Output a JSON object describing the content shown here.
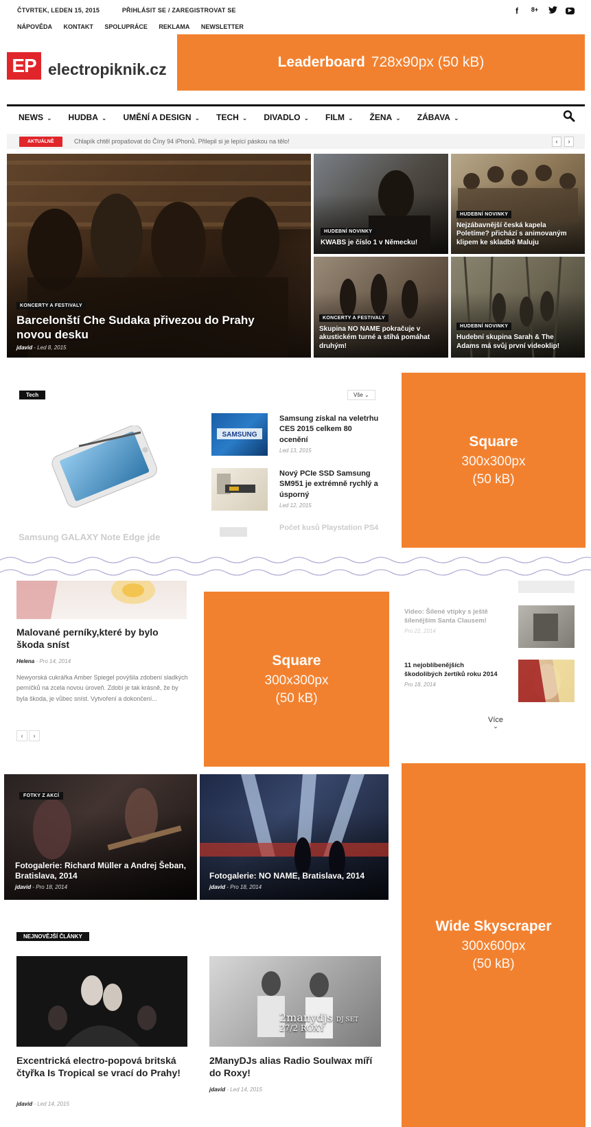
{
  "topbar": {
    "date": "ČTVRTEK, LEDEN 15, 2015",
    "login": "PŘIHLÁSIT SE / ZAREGISTROVAT SE",
    "links": [
      "NÁPOVĚDA",
      "KONTAKT",
      "SPOLUPRÁCE",
      "REKLAMA",
      "NEWSLETTER"
    ],
    "social": [
      "f",
      "8+",
      "▶"
    ]
  },
  "logo": {
    "mark": "EP",
    "name": "electropiknik.cz"
  },
  "ads": {
    "leaderboard": {
      "title": "Leaderboard",
      "size": "728x90px (50 kB)"
    },
    "square1": {
      "title": "Square",
      "size": "300x300px",
      "weight": "(50 kB)"
    },
    "square2": {
      "title": "Square",
      "size": "300x300px",
      "weight": "(50 kB)"
    },
    "skyscraper": {
      "title": "Wide Skyscraper",
      "size": "300x600px",
      "weight": "(50 kB)"
    }
  },
  "nav": {
    "items": [
      "NEWS",
      "HUDBA",
      "UMĚNÍ A DESIGN",
      "TECH",
      "DIVADLO",
      "FILM",
      "ŽENA",
      "ZÁBAVA"
    ],
    "chevron": "⌄"
  },
  "ticker": {
    "badge": "AKTUÁLNĚ",
    "text": "Chlapík chtěl propašovat do Číny 94 iPhonů. Přilepil si je lepící páskou na tělo!",
    "prev": "‹",
    "next": "›"
  },
  "hero": {
    "main": {
      "cat": "KONCERTY A FESTIVALY",
      "title": "Barcelonští Che Sudaka přivezou do Prahy novou desku",
      "author": "jdavid",
      "date": "Led 8, 2015"
    },
    "t1": {
      "cat": "HUDEBNÍ NOVINKY",
      "title": "KWABS je číslo 1 v Německu!"
    },
    "t2": {
      "cat": "HUDEBNÍ NOVINKY",
      "title": "Nejzábavnější česká kapela Poletíme? přichází s animovaným klipem ke skladbě Maluju"
    },
    "t3": {
      "cat": "KONCERTY A FESTIVALY",
      "title": "Skupina NO NAME pokračuje v akustickém turné a stíhá pomáhat druhým!"
    },
    "t4": {
      "cat": "HUDEBNÍ NOVINKY",
      "title": "Hudební skupina Sarah & The Adams má svůj první videoklip!"
    }
  },
  "tech": {
    "tag": "Tech",
    "filter": "Vše",
    "filter_chev": "⌄",
    "faded_title": "Samsung GALAXY Note Edge jde",
    "items": [
      {
        "title": "Samsung získal na veletrhu CES 2015 celkem 80 ocenění",
        "date": "Led 13, 2015"
      },
      {
        "title": "Nový PCIe SSD Samsung SM951 je extrémně rychlý a úsporný",
        "date": "Led 12, 2015"
      },
      {
        "title": "Počet kusů Playstation PS4",
        "date": ""
      }
    ]
  },
  "lower": {
    "main": {
      "title": "Malované perníky,které by bylo škoda sníst",
      "author": "Helena",
      "date": "Pro 14, 2014",
      "excerpt": "Newyorská cukrářka Amber Spiegel povýšila zdobení sladkých perníčků na zcela novou úroveň. Zdobí je tak krásně, že by byla škoda, je vůbec sníst. Vytvoření a dokončení...",
      "prev": "‹",
      "next": "›"
    },
    "side": [
      {
        "title": "Video: Šílené vtípky s ještě šílenějším Santa Clausem!",
        "date": "Pro 22, 2014"
      },
      {
        "title": "11 nejoblíbenějších škodolibých žertíků roku 2014",
        "date": "Pro 18, 2014"
      }
    ],
    "more": "Více",
    "more_chev": "⌄"
  },
  "gallery": [
    {
      "cat": "FOTKY Z AKCÍ",
      "title": "Fotogalerie: Richard Müller a Andrej Šeban, Bratislava, 2014",
      "author": "jdavid",
      "date": "Pro 18, 2014"
    },
    {
      "title": "Fotogalerie: NO NAME, Bratislava, 2014",
      "author": "jdavid",
      "date": "Pro 18, 2014"
    }
  ],
  "latest": {
    "tag": "NEJNOVĚJŠÍ ČLÁNKY",
    "poster_line1": "2manydjs",
    "poster_dj": "DJ SET",
    "poster_line2": "27/2 ROXY",
    "items": [
      {
        "title": "Excentrická electro-popová britská čtyřka Is Tropical se vrací do Prahy!",
        "author": "jdavid",
        "date": "Led 14, 2015"
      },
      {
        "title": "2ManyDJs alias Radio Soulwax míří do Roxy!",
        "author": "jdavid",
        "date": "Led 14, 2015"
      }
    ]
  },
  "colors": {
    "accent": "#f2812f",
    "brand": "#e0262b",
    "text": "#111111"
  }
}
